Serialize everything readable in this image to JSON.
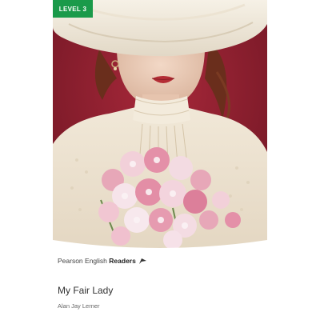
{
  "badge": {
    "label": "LEVEL 3",
    "color": "#1a9a4a"
  },
  "series": {
    "brand": "Pearson English",
    "readers": "Readers"
  },
  "book": {
    "title": "My Fair Lady",
    "author": "Alan Jay Lerner"
  },
  "icons": {
    "series_mark": "flag-icon"
  }
}
